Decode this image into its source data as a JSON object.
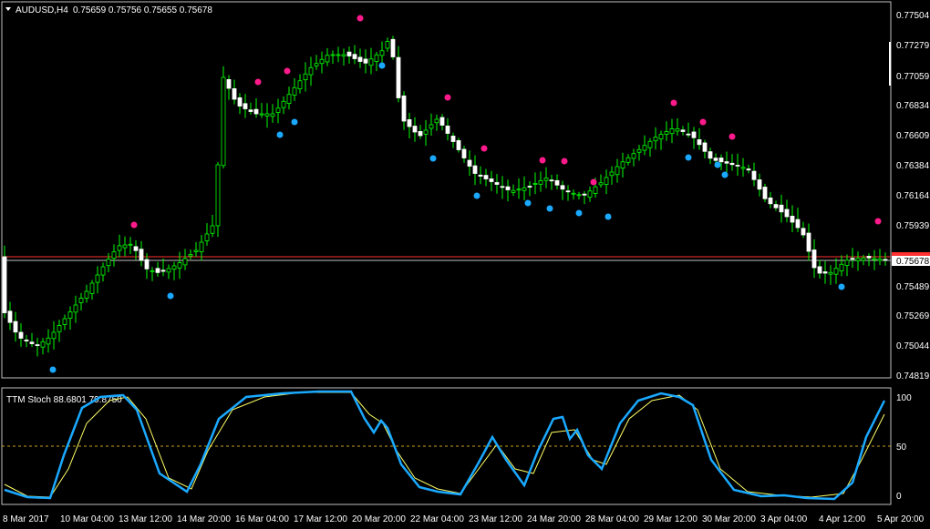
{
  "header": {
    "symbol": "AUDUSD,H4",
    "ohlc": "0.75659 0.75756 0.75655 0.75678"
  },
  "price_axis": {
    "ticks": [
      "0.77504",
      "0.77279",
      "0.77059",
      "0.76834",
      "0.76609",
      "0.76384",
      "0.76164",
      "0.75939",
      "0.75489",
      "0.75269",
      "0.75044",
      "0.74819"
    ],
    "current_price_label": "0.75678"
  },
  "indicator": {
    "title": "TTM Stoch 88.6801 79.8750",
    "levels": [
      "100",
      "50",
      "0"
    ]
  },
  "time_axis": {
    "labels": [
      "8 Mar 2017",
      "10 Mar 04:00",
      "13 Mar 12:00",
      "14 Mar 20:00",
      "16 Mar 04:00",
      "17 Mar 12:00",
      "20 Mar 20:00",
      "22 Mar 04:00",
      "23 Mar 12:00",
      "24 Mar 20:00",
      "28 Mar 04:00",
      "29 Mar 12:00",
      "30 Mar 20:00",
      "3 Apr 04:00",
      "4 Apr 12:00",
      "5 Apr 20:00"
    ]
  },
  "colors": {
    "background": "#000000",
    "bull_candle": "#ffffff",
    "bear_candle": "#ffffff",
    "wick": "#00ff00",
    "magenta_dot": "#ff1a8c",
    "cyan_dot": "#1aa9ff",
    "stoch_main": "#1aa9ff",
    "stoch_signal": "#ffff66",
    "level_line": "#c8a020",
    "price_line": "#c0c0c0",
    "red_line": "#ff3030"
  }
}
